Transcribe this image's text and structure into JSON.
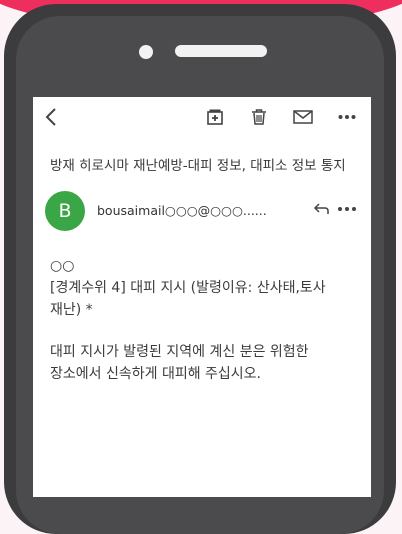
{
  "toolbar": {
    "back_icon": "chevron-left-icon",
    "archive_icon": "archive-add-icon",
    "delete_icon": "trash-icon",
    "mail_icon": "envelope-icon",
    "more_icon": "more-horizontal-icon"
  },
  "email": {
    "subject": "방재 히로시마 재난예방-대피 정보, 대피소 정보 통지",
    "avatar_letter": "B",
    "sender": "bousaimail○○○@○○○......",
    "body": {
      "line1": "○○",
      "line2": "[경계수위 4] 대피 지시 (발령이유: 산사태,토사",
      "line3": "재난) *",
      "line4": "대피 지시가 발령된 지역에 계신 분은 위험한",
      "line5": "장소에서 신속하게 대피해 주십시오."
    }
  },
  "colors": {
    "accent": "#ee2f5d",
    "avatar": "#3aa646",
    "phone": "#3c3c3e"
  }
}
